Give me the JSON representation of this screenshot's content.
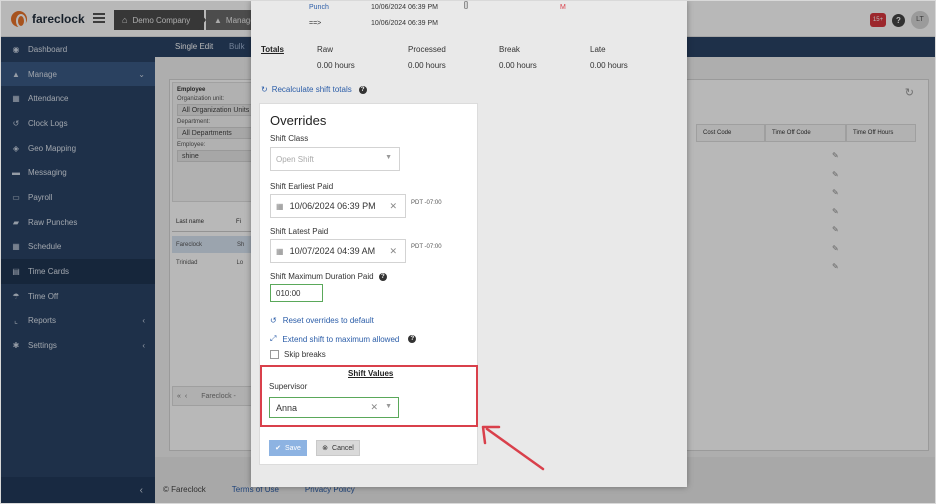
{
  "app": {
    "brand": "fareclock"
  },
  "topbar": {
    "breadcrumb_company": "Demo Company",
    "breadcrumb_section": "Manage",
    "notification_count": "15+",
    "help_glyph": "?",
    "user_initials": "LT"
  },
  "sidebar": {
    "items": [
      {
        "label": "Dashboard",
        "icon": "dashboard-icon",
        "glyph": "◉"
      },
      {
        "label": "Manage",
        "icon": "user-icon",
        "glyph": "▲",
        "chev": "⌄"
      },
      {
        "label": "Attendance",
        "icon": "attendance-icon",
        "glyph": "▦"
      },
      {
        "label": "Clock Logs",
        "icon": "history-icon",
        "glyph": "↺"
      },
      {
        "label": "Geo Mapping",
        "icon": "map-icon",
        "glyph": "◈"
      },
      {
        "label": "Messaging",
        "icon": "chat-icon",
        "glyph": "▬"
      },
      {
        "label": "Payroll",
        "icon": "payroll-icon",
        "glyph": "▭"
      },
      {
        "label": "Raw Punches",
        "icon": "punch-icon",
        "glyph": "▰"
      },
      {
        "label": "Schedule",
        "icon": "calendar-icon",
        "glyph": "▦"
      },
      {
        "label": "Time Cards",
        "icon": "timecard-icon",
        "glyph": "▤"
      },
      {
        "label": "Time Off",
        "icon": "umbrella-icon",
        "glyph": "☂"
      },
      {
        "label": "Reports",
        "icon": "chart-icon",
        "glyph": "⌞",
        "chev": "‹"
      },
      {
        "label": "Settings",
        "icon": "gear-icon",
        "glyph": "✱",
        "chev": "‹"
      }
    ],
    "collapse_glyph": "‹"
  },
  "main": {
    "tabs": [
      "Single Edit",
      "Bulk"
    ],
    "filters": {
      "employee_header": "Employee",
      "org_label": "Organization unit:",
      "org_value": "All Organization Units",
      "dept_label": "Department:",
      "dept_value": "All Departments",
      "emp_label": "Employee:",
      "emp_value": "shine"
    },
    "list": {
      "col_last": "Last name",
      "col_first": "Fi",
      "rows": [
        {
          "last": "Fareclock",
          "first": "Sh"
        },
        {
          "last": "Trinidad",
          "first": "Lo"
        }
      ]
    },
    "pager_label": "Fareclock -",
    "grid_headers": [
      "Cost Code",
      "Time Off Code",
      "Time Off Hours"
    ],
    "footer": {
      "copyright": "© Fareclock",
      "terms": "Terms of Use",
      "privacy": "Privacy Policy"
    }
  },
  "modal": {
    "punch_link": "Punch",
    "punch_time_1": "10/06/2024 06:39 PM",
    "punch_arrow": "==>",
    "punch_time_2": "10/06/2024 06:39 PM",
    "punch_flag": "M",
    "totals": {
      "label": "Totals",
      "columns": [
        {
          "name": "Raw",
          "value": "0.00 hours"
        },
        {
          "name": "Processed",
          "value": "0.00 hours"
        },
        {
          "name": "Break",
          "value": "0.00 hours"
        },
        {
          "name": "Late",
          "value": "0.00 hours"
        }
      ]
    },
    "recalc_label": "Recalculate shift totals",
    "overrides": {
      "title": "Overrides",
      "shift_class_label": "Shift Class",
      "shift_class_placeholder": "Open Shift",
      "earliest_label": "Shift Earliest Paid",
      "earliest_value": "10/06/2024 06:39 PM",
      "earliest_tz": "PDT -07:00",
      "latest_label": "Shift Latest Paid",
      "latest_value": "10/07/2024 04:39 AM",
      "latest_tz": "PDT -07:00",
      "max_duration_label": "Shift Maximum Duration Paid",
      "max_duration_value": "010:00",
      "reset_label": "Reset overrides to default",
      "extend_label": "Extend shift to maximum allowed",
      "skip_breaks_label": "Skip breaks",
      "skip_breaks_checked": false
    },
    "shift_values": {
      "title": "Shift Values",
      "supervisor_label": "Supervisor",
      "supervisor_value": "Anna"
    },
    "buttons": {
      "save": "Save",
      "cancel": "Cancel"
    }
  },
  "colors": {
    "sidebar": "#2a4366",
    "accent_link": "#2b5da8",
    "highlight": "#d9404b",
    "brand_orange": "#e8732a"
  }
}
